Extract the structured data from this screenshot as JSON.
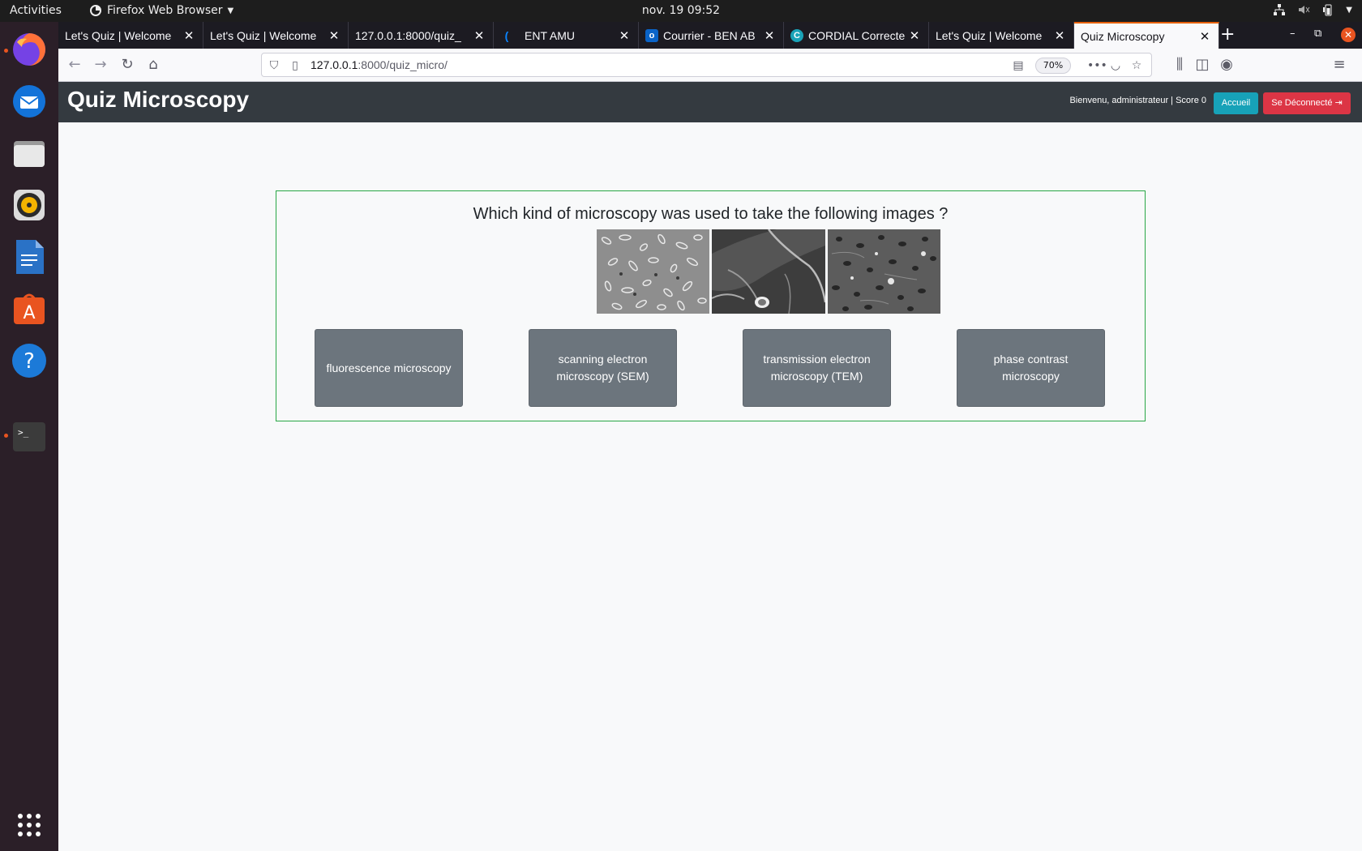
{
  "system": {
    "activities": "Activities",
    "app_name": "Firefox Web Browser",
    "clock": "nov. 19  09:52"
  },
  "dock": {
    "items": [
      "firefox-icon",
      "thunderbird-icon",
      "files-icon",
      "rhythmbox-icon",
      "writer-icon",
      "software-icon",
      "help-icon",
      "terminal-icon",
      "app-grid-icon"
    ]
  },
  "browser": {
    "tabs": [
      {
        "title": "Let's Quiz | Welcome"
      },
      {
        "title": "Let's Quiz | Welcome"
      },
      {
        "title": "127.0.0.1:8000/quiz_"
      },
      {
        "title": "ENT AMU"
      },
      {
        "title": "Courrier - BEN AB"
      },
      {
        "title": "CORDIAL Correcte"
      },
      {
        "title": "Let's Quiz | Welcome"
      },
      {
        "title": "Quiz Microscopy"
      }
    ],
    "url_host": "127.0.0.1",
    "url_path": ":8000/quiz_micro/",
    "zoom": "70%",
    "accent_color": "#e66000"
  },
  "site": {
    "title": "Quiz Microscopy",
    "welcome": "Bienvenu, administrateur | Score 0",
    "home_label": "Accueil",
    "logout_label": "Se Déconnecté",
    "header_color": "#343a40",
    "border_color": "#28a745"
  },
  "quiz": {
    "question": "Which kind of microscopy was used to take the following images ?",
    "answers": [
      {
        "label": "fluorescence microscopy"
      },
      {
        "label": "scanning electron microscopy (SEM)"
      },
      {
        "label": "transmission electron microscopy (TEM)"
      },
      {
        "label": "phase contrast microscopy"
      }
    ]
  }
}
